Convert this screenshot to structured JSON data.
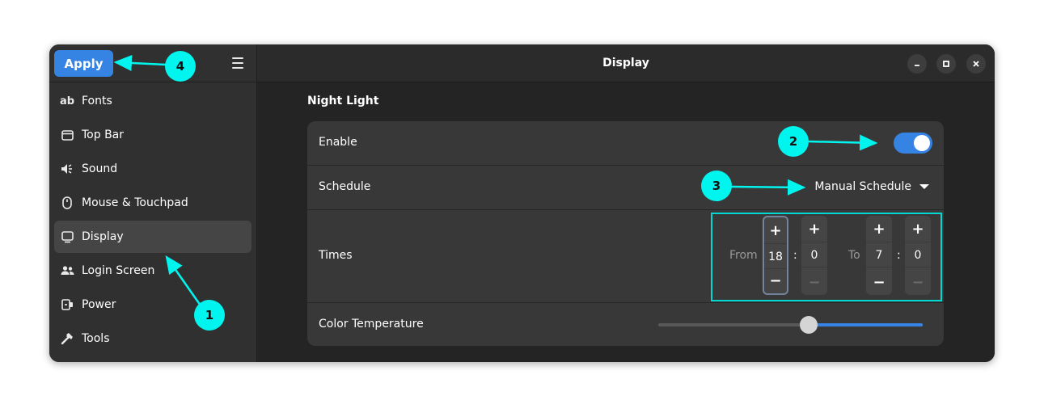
{
  "sidebar": {
    "apply_label": "Apply",
    "items": [
      {
        "label": "Fonts",
        "icon": "ab-text-icon"
      },
      {
        "label": "Top Bar",
        "icon": "window-icon"
      },
      {
        "label": "Sound",
        "icon": "speaker-icon"
      },
      {
        "label": "Mouse & Touchpad",
        "icon": "mouse-icon"
      },
      {
        "label": "Display",
        "icon": "monitor-icon",
        "active": true
      },
      {
        "label": "Login Screen",
        "icon": "users-icon"
      },
      {
        "label": "Power",
        "icon": "plug-icon"
      },
      {
        "label": "Tools",
        "icon": "hammer-icon"
      }
    ]
  },
  "header": {
    "title": "Display"
  },
  "night_light": {
    "section_title": "Night Light",
    "enable_label": "Enable",
    "enabled": true,
    "schedule_label": "Schedule",
    "schedule_value": "Manual Schedule",
    "times_label": "Times",
    "from_label": "From",
    "to_label": "To",
    "separator": ":",
    "from_hour": "18",
    "from_minute": "0",
    "to_hour": "7",
    "to_minute": "0",
    "plus": "+",
    "minus": "−",
    "color_temp_label": "Color Temperature",
    "color_temp_position": 0.57
  },
  "annotations": {
    "c1": "1",
    "c2": "2",
    "c3": "3",
    "c4": "4"
  },
  "colors": {
    "accent": "#3584e4",
    "annotation": "#00f5ee"
  }
}
